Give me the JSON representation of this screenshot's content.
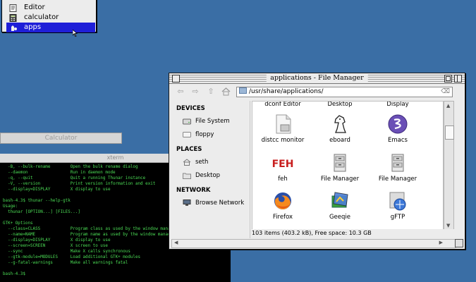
{
  "menu": {
    "items": [
      {
        "label": "Editor",
        "icon": "editor-icon"
      },
      {
        "label": "calculator",
        "icon": "calculator-icon"
      },
      {
        "label": "apps",
        "icon": "apps-icon",
        "selected": true
      }
    ]
  },
  "calculator_window": {
    "title": "Calculator"
  },
  "xterm": {
    "title": "xterm",
    "lines": [
      "  -B, --bulk-rename        Open the bulk rename dialog",
      "  --daemon                 Run in daemon mode",
      "  -q, --quit               Quit a running Thunar instance",
      "  -V, --version            Print version information and exit",
      "  --display=DISPLAY        X display to use",
      "",
      "bash-4.3$ thunar --help-gtk",
      "Usage:",
      "  thunar [OPTION...] [FILES...]",
      "",
      "GTK+ Options",
      "  --class=CLASS            Program class as used by the window manager",
      "  --name=NAME              Program name as used by the window manager",
      "  --display=DISPLAY        X display to use",
      "  --screen=SCREEN          X screen to use",
      "  --sync                   Make X calls synchronous",
      "  --gtk-module=MODULES     Load additional GTK+ modules",
      "  --g-fatal-warnings       Make all warnings fatal",
      "",
      "bash-4.3$ "
    ]
  },
  "file_manager": {
    "title": "applications - File Manager",
    "path": "/usr/share/applications/",
    "sidebar": {
      "sections": [
        {
          "heading": "DEVICES",
          "items": [
            {
              "label": "File System",
              "icon": "hard-drive-icon"
            },
            {
              "label": "floppy",
              "icon": "floppy-icon"
            }
          ]
        },
        {
          "heading": "PLACES",
          "items": [
            {
              "label": "seth",
              "icon": "home-icon"
            },
            {
              "label": "Desktop",
              "icon": "desktop-folder-icon"
            }
          ]
        },
        {
          "heading": "NETWORK",
          "items": [
            {
              "label": "Browse Network",
              "icon": "network-icon"
            }
          ]
        }
      ]
    },
    "top_row_labels": [
      "dconf Editor",
      "Desktop",
      "Display"
    ],
    "files": [
      {
        "label": "distcc monitor",
        "icon": "document-icon"
      },
      {
        "label": "eboard",
        "icon": "chess-knight-icon"
      },
      {
        "label": "Emacs",
        "icon": "emacs-icon"
      },
      {
        "label": "feh",
        "icon": "feh-logo-icon",
        "logo_text": "FEH"
      },
      {
        "label": "File Manager",
        "icon": "file-manager-icon"
      },
      {
        "label": "File Manager",
        "icon": "file-manager-icon"
      },
      {
        "label": "Firefox",
        "icon": "firefox-icon"
      },
      {
        "label": "Geeqie",
        "icon": "geeqie-icon"
      },
      {
        "label": "gFTP",
        "icon": "gftp-icon"
      }
    ],
    "status": "103 items (403.2 kB), Free space: 10.3 GB"
  }
}
